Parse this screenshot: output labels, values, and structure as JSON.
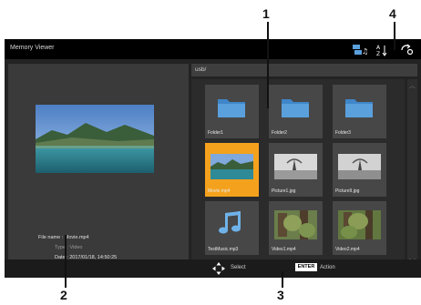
{
  "callouts": [
    "1",
    "2",
    "3",
    "4"
  ],
  "app_title": "Memory Viewer",
  "path": "usb/",
  "info": {
    "file_name_label": "File name :",
    "file_name": "Movie.mp4",
    "type_label": "Type :",
    "type": "Video",
    "date_label": "Date :",
    "date": "2017/01/18, 14:50:25"
  },
  "tiles": [
    {
      "label": "Folder1",
      "icon": "folder-icon"
    },
    {
      "label": "Folder2",
      "icon": "folder-icon"
    },
    {
      "label": "Folder3",
      "icon": "folder-icon"
    },
    {
      "label": "Movie.mp4",
      "icon": "video-thumbnail",
      "selected": true
    },
    {
      "label": "Picture1.jpg",
      "icon": "picture-thumbnail"
    },
    {
      "label": "Picture9.jpg",
      "icon": "picture-thumbnail"
    },
    {
      "label": "TestMusic.mp3",
      "icon": "music-note-icon"
    },
    {
      "label": "Video1.mp4",
      "icon": "video-thumbnail"
    },
    {
      "label": "Video2.mp4",
      "icon": "video-thumbnail"
    }
  ],
  "footer": {
    "select_label": "Select",
    "enter_key": "ENTER",
    "action_label": "Action"
  },
  "colors": {
    "selection": "#f4a21d",
    "folder": "#5aa0dd",
    "music": "#6fb2e8"
  }
}
